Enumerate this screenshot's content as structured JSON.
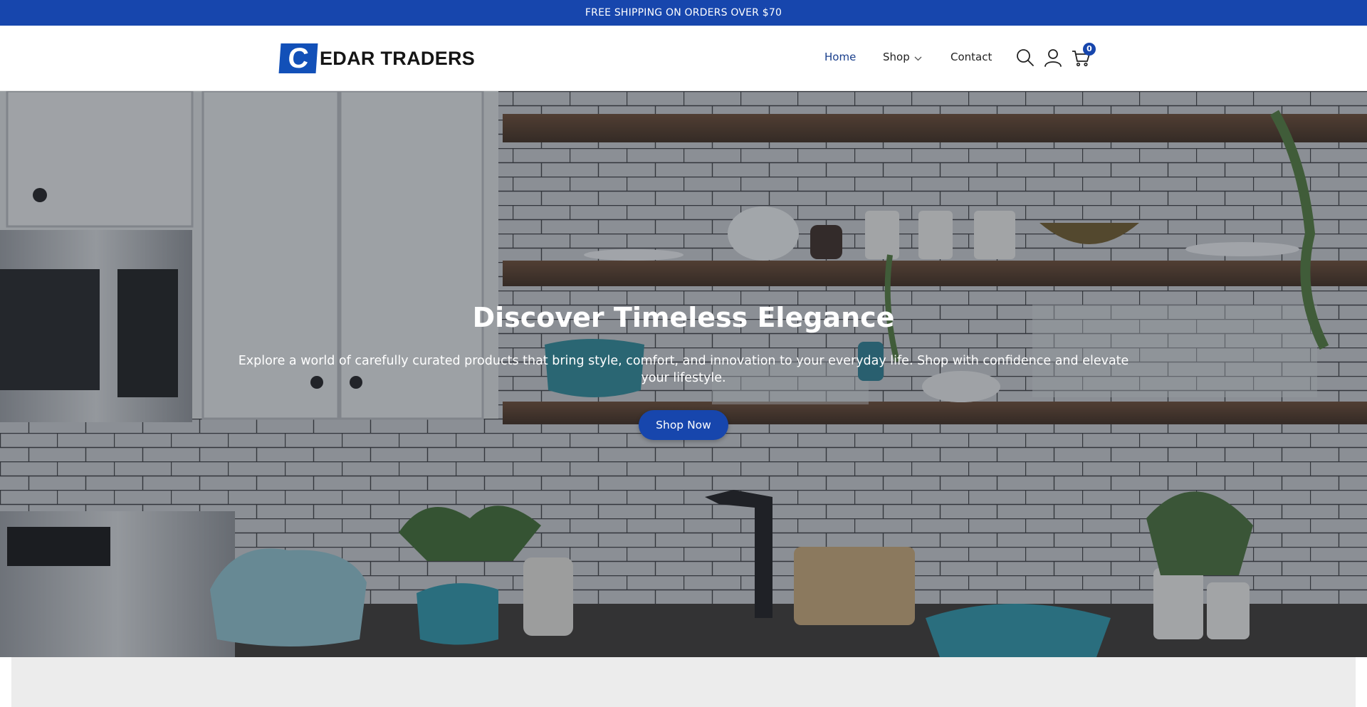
{
  "announcement": {
    "text": "FREE SHIPPING ON ORDERS OVER $70"
  },
  "brand": {
    "mark": "C",
    "name": "EDAR TRADERS",
    "color": "#1250b8"
  },
  "nav": {
    "items": [
      {
        "label": "Home",
        "active": true
      },
      {
        "label": "Shop",
        "has_dropdown": true
      },
      {
        "label": "Contact"
      }
    ]
  },
  "header_icons": {
    "search": "search-icon",
    "account": "user-icon",
    "cart": "cart-icon",
    "cart_count": "0"
  },
  "hero": {
    "title": "Discover Timeless Elegance",
    "subtitle": "Explore a world of carefully curated products that bring style, comfort, and innovation to your everyday life. Shop with confidence and elevate your lifestyle.",
    "cta_label": "Shop Now"
  },
  "colors": {
    "accent": "#1746ad",
    "nav_active": "#1a3f8c",
    "section_bg": "#ececec"
  }
}
